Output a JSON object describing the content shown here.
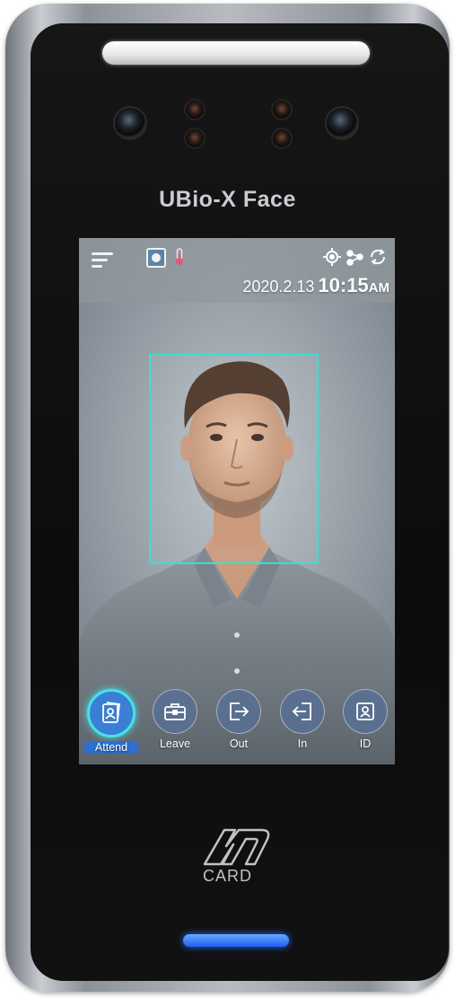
{
  "device": {
    "brand": "UBio-X Face",
    "card_reader_label": "CARD"
  },
  "screen": {
    "date": "2020.2.13",
    "time": "10:15",
    "ampm": "AM",
    "icons": [
      "menu-icon",
      "camera-icon",
      "thermometer-icon",
      "gps-icon",
      "network-icon",
      "sync-icon"
    ],
    "actions": [
      {
        "label": "Attend",
        "icon": "attend-icon",
        "active": true
      },
      {
        "label": "Leave",
        "icon": "briefcase-icon",
        "active": false
      },
      {
        "label": "Out",
        "icon": "exit-icon",
        "active": false
      },
      {
        "label": "In",
        "icon": "enter-icon",
        "active": false
      },
      {
        "label": "ID",
        "icon": "id-card-icon",
        "active": false
      }
    ]
  },
  "colors": {
    "face_frame": "#38e0d0",
    "active_action": "#3a7fd4",
    "status_led": "#1e5ff2"
  }
}
